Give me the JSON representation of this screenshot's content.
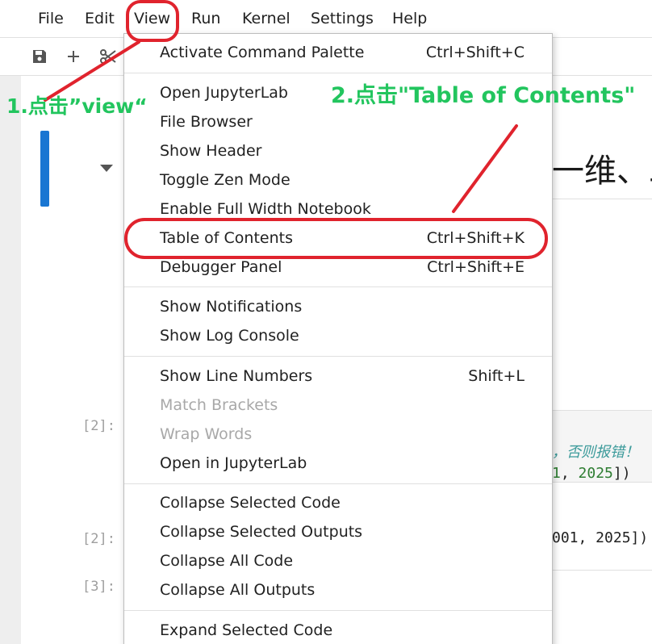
{
  "menubar": {
    "file": "File",
    "edit": "Edit",
    "view": "View",
    "run": "Run",
    "kernel": "Kernel",
    "settings": "Settings",
    "help": "Help"
  },
  "toolbar": {
    "save_icon": "save-icon",
    "add_icon": "plus-icon",
    "cut_icon": "scissors-icon"
  },
  "notebook": {
    "heading_fragment": "一维、二",
    "prompts": [
      "[2]:",
      "[2]:",
      "[3]:"
    ],
    "code_comment": "，否则报错！",
    "code_line_num1": "1",
    "code_line_sep": ", ",
    "code_line_num2": "2025",
    "code_line_tail": "])",
    "output_line": "001, 2025])"
  },
  "view_menu": {
    "items": [
      {
        "label": "Activate Command Palette",
        "shortcut": "Ctrl+Shift+C"
      },
      {
        "label": "Open JupyterLab",
        "shortcut": ""
      },
      {
        "label": "File Browser",
        "shortcut": ""
      },
      {
        "label": "Show Header",
        "shortcut": ""
      },
      {
        "label": "Toggle Zen Mode",
        "shortcut": ""
      },
      {
        "label": "Enable Full Width Notebook",
        "shortcut": ""
      },
      {
        "label": "Table of Contents",
        "shortcut": "Ctrl+Shift+K"
      },
      {
        "label": "Debugger Panel",
        "shortcut": "Ctrl+Shift+E"
      },
      {
        "label": "Show Notifications",
        "shortcut": ""
      },
      {
        "label": "Show Log Console",
        "shortcut": ""
      },
      {
        "label": "Show Line Numbers",
        "shortcut": "Shift+L"
      },
      {
        "label": "Match Brackets",
        "shortcut": "",
        "disabled": true
      },
      {
        "label": "Wrap Words",
        "shortcut": "",
        "disabled": true
      },
      {
        "label": "Open in JupyterLab",
        "shortcut": ""
      },
      {
        "label": "Collapse Selected Code",
        "shortcut": ""
      },
      {
        "label": "Collapse Selected Outputs",
        "shortcut": ""
      },
      {
        "label": "Collapse All Code",
        "shortcut": ""
      },
      {
        "label": "Collapse All Outputs",
        "shortcut": ""
      },
      {
        "label": "Expand Selected Code",
        "shortcut": ""
      }
    ]
  },
  "annotations": {
    "step1": "1.点击”view“",
    "step2": "2.点击\"Table of Contents\"",
    "color": "#22c55e",
    "highlight_color": "#e0232d"
  },
  "colors": {
    "active_cell": "#1976d2",
    "disabled_text": "#a8a8a8"
  }
}
